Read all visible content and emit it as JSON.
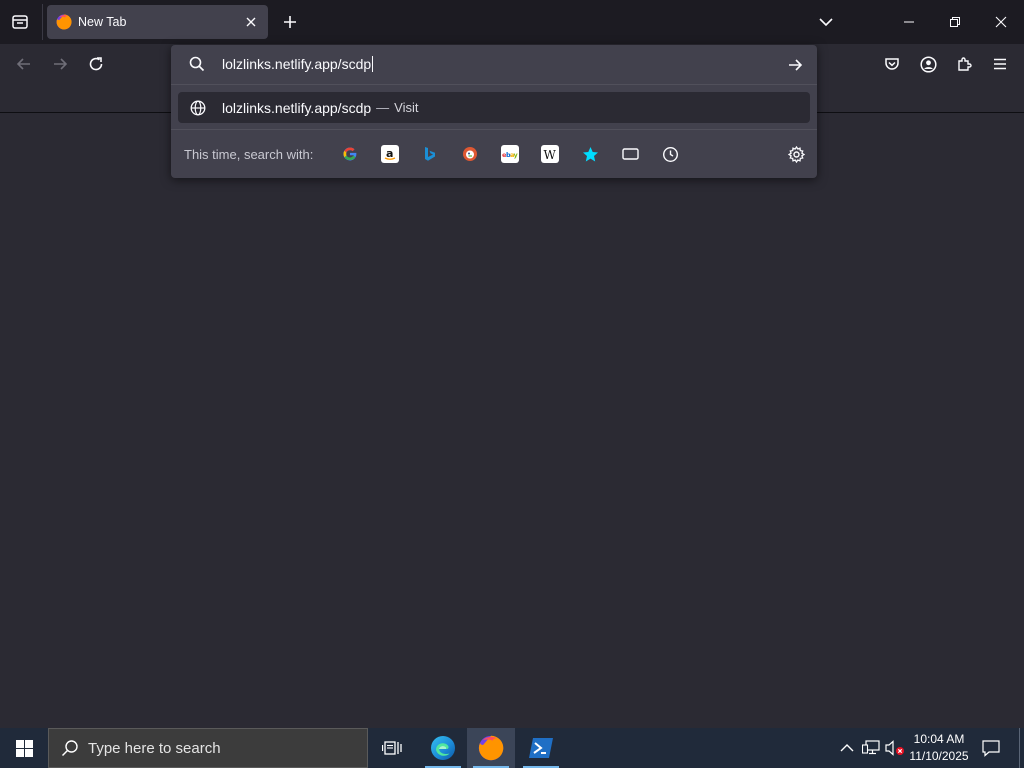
{
  "tab": {
    "title": "New Tab"
  },
  "urlbar": {
    "value": "lolzlinks.netlify.app/scdp",
    "result": {
      "url": "lolzlinks.netlify.app/scdp",
      "separator": "—",
      "action": "Visit"
    },
    "oneoff_label": "This time, search with:",
    "engines": [
      "google-icon",
      "amazon-icon",
      "bing-icon",
      "duckduckgo-icon",
      "ebay-icon",
      "wikipedia-icon",
      "bookmarks-star-icon",
      "tabs-icon",
      "history-icon"
    ]
  },
  "taskbar": {
    "search_placeholder": "Type here to search",
    "time": "10:04 AM",
    "date": "11/10/2025"
  },
  "colors": {
    "tab_bar": "#1c1b22",
    "toolbar": "#2b2a33",
    "urlbar_popup": "#42414d",
    "taskbar": "#202a3a",
    "accent": "#0df"
  }
}
